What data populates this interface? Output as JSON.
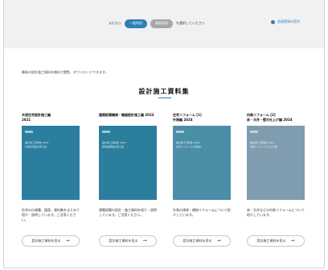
{
  "header": {
    "prefix": "まだなら",
    "tab_active": "一般利用",
    "tab_other": "業務利用",
    "suffix": "を選択してください",
    "right_link": "会員登録の案内"
  },
  "intro_text": "最新の設計施工資料を無料で閲覧、ダウンロードできます。",
  "section_title": "設計施工資料集",
  "cards": [
    {
      "name": "木造住宅設計施工編",
      "year": "2021",
      "cover_color": "#2c7e9f",
      "cover_line1": "設計施工資料集 2021",
      "cover_line2": "木造住宅設計施工編",
      "desc": "住宅の仕様書、図面、資料集をまとめて紹介・説明しています。ご活用ください。",
      "button": "設計施工資料を見る"
    },
    {
      "name": "建築設備機械・機器設計施工編 2023",
      "year": "",
      "cover_color": "#2b7f9c",
      "cover_line1": "設計施工資料集 2023",
      "cover_line2": "建築設備設計施工編",
      "desc": "建築設備の設計・施工資料を紹介・説明しています。ご活用ください。",
      "button": "設計施工資料を見る"
    },
    {
      "name": "住宅リフォーム [1]",
      "year": "外装編 2024",
      "cover_color": "#4a8ea8",
      "cover_line1": "設計施工資料集 2024",
      "cover_line2": "住宅リフォーム 外装編",
      "desc": "外装の改修・補修リフォームについて紹介しています。",
      "button": "設計施工資料を見る"
    },
    {
      "name": "内装リフォーム [2]",
      "year": "床・天井・壁の仕上げ編 2024",
      "cover_color": "#7f9daf",
      "cover_line1": "設計施工資料集 2024",
      "cover_line2": "内装リフォーム 仕上げ編",
      "desc": "床・天井などの内装リフォームについて紹介しています。",
      "button": "設計施工資料を見る"
    }
  ]
}
